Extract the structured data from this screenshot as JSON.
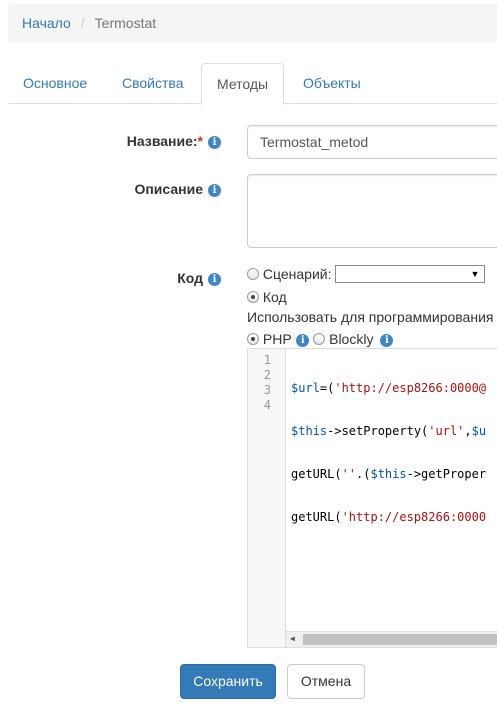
{
  "breadcrumb": {
    "home": "Начало",
    "current": "Termostat"
  },
  "tabs": [
    "Основное",
    "Свойства",
    "Методы",
    "Объекты"
  ],
  "form": {
    "name_label": "Название:",
    "name_required": "*",
    "name_value": "Termostat_metod",
    "description_label": "Описание",
    "description_value": "",
    "code_label": "Код",
    "scenario_option": "Сценарий:",
    "code_option": "Код",
    "use_for_programming": "Использовать для программирования",
    "php_option": "PHP",
    "blockly_option": "Blockly"
  },
  "editor": {
    "line_numbers": [
      "1",
      "2",
      "3",
      "4"
    ]
  },
  "buttons": {
    "save": "Сохранить",
    "cancel": "Отмена"
  },
  "colors": {
    "accent": "#337ab7",
    "info_icon": "#3f87c4",
    "required": "#c9302c"
  },
  "icons": {
    "info": "info-icon",
    "dropdown": "chevron-down-icon"
  }
}
